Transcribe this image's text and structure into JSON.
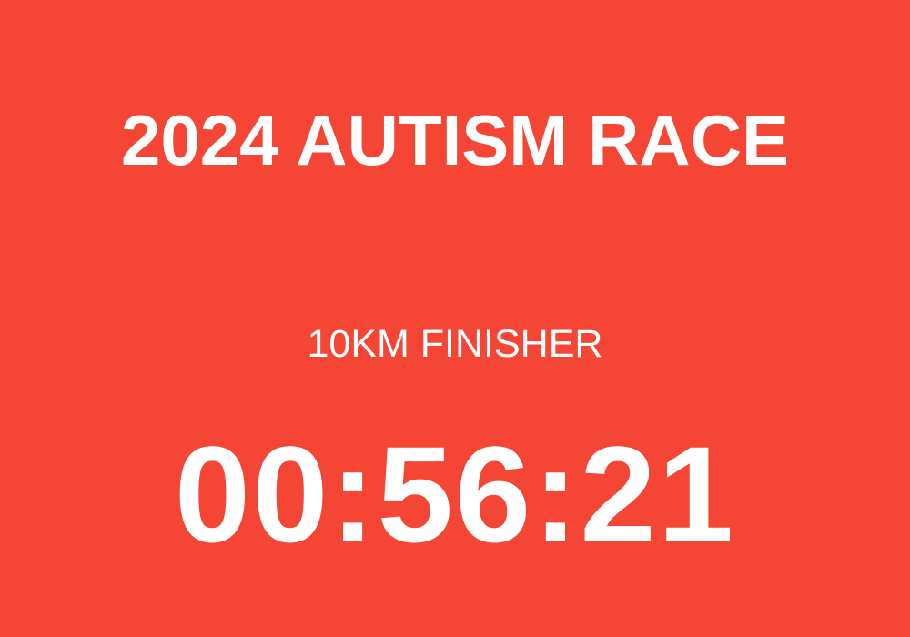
{
  "colors": {
    "background": "#F54535",
    "text": "#FFFFFF"
  },
  "card": {
    "title": "2024 AUTISM RACE",
    "category": "10KM FINISHER",
    "finish_time": "00:56:21"
  }
}
